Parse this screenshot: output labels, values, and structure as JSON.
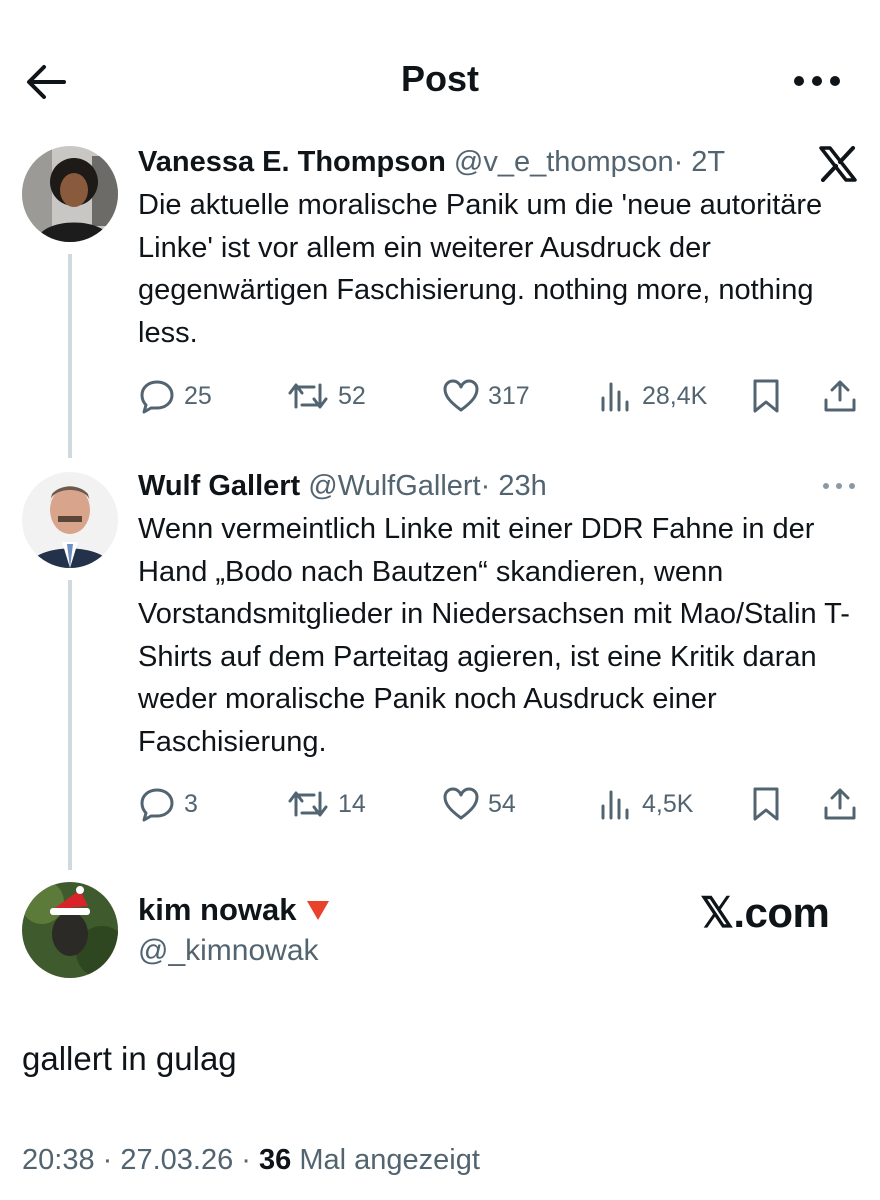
{
  "header": {
    "title": "Post",
    "back_icon": "arrow-left-icon",
    "more_icon": "more-dots-icon"
  },
  "tweets": [
    {
      "name": "Vanessa E. Thompson",
      "handle": "@v_e_thompson",
      "time": "· 2T",
      "text": "Die aktuelle moralische Panik um die 'neue autoritäre Linke' ist vor allem ein weiterer Ausdruck der gegenwärtigen Faschisierung. nothing more, nothing less.",
      "replies": "25",
      "retweets": "52",
      "likes": "317",
      "views": "28,4K"
    },
    {
      "name": "Wulf Gallert",
      "handle": "@WulfGallert",
      "time": "· 23h",
      "text": "Wenn vermeintlich Linke mit einer DDR Fahne in der Hand „Bodo nach Bautzen“ skandieren, wenn Vorstandsmitglieder in Niedersachsen mit Mao/Stalin T-Shirts auf dem Parteitag agieren, ist eine Kritik daran weder moralische Panik noch Ausdruck einer Faschisierung.",
      "replies": "3",
      "retweets": "14",
      "likes": "54",
      "views": "4,5K"
    }
  ],
  "quote_author": {
    "name": "kim nowak",
    "emoji": "🔻",
    "handle": "@_kimnowak"
  },
  "watermark": "𝕏.com",
  "reply_text": "gallert in gulag",
  "footer": {
    "time": "20:38 · 27.03.26 · ",
    "views": "36",
    "views_label": " Mal angezeigt"
  }
}
